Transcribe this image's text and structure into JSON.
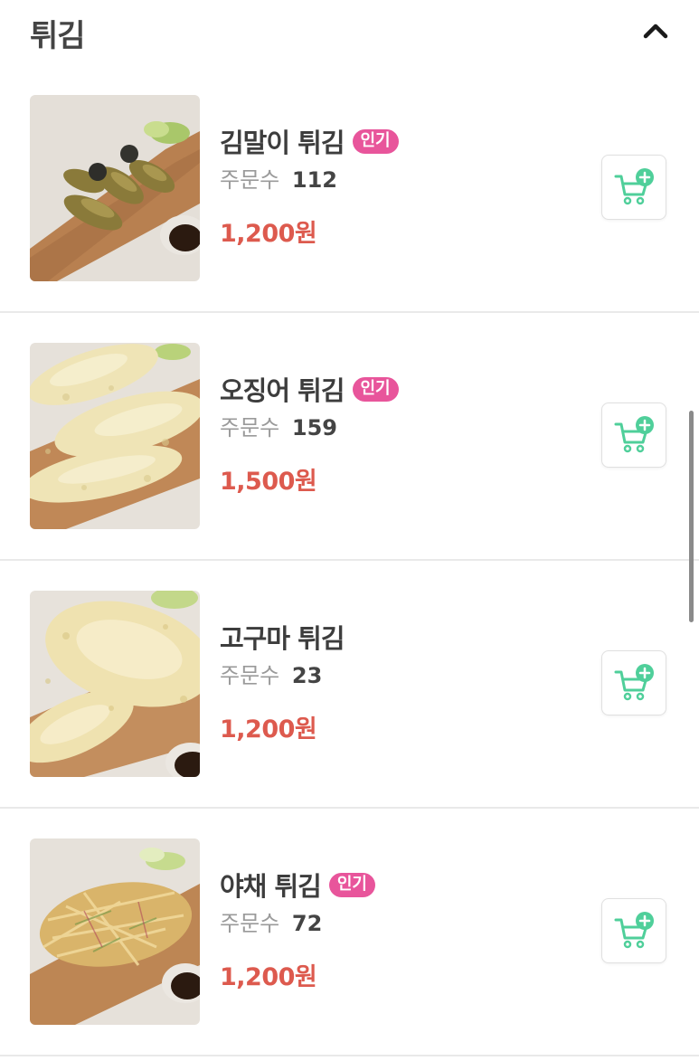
{
  "header": {
    "title": "튀김"
  },
  "items": [
    {
      "name": "김말이 튀김",
      "badge": "인기",
      "orders_label": "주문수",
      "orders": "112",
      "price": "1,200원"
    },
    {
      "name": "오징어 튀김",
      "badge": "인기",
      "orders_label": "주문수",
      "orders": "159",
      "price": "1,500원"
    },
    {
      "name": "고구마 튀김",
      "badge": "",
      "orders_label": "주문수",
      "orders": "23",
      "price": "1,200원"
    },
    {
      "name": "야채 튀김",
      "badge": "인기",
      "orders_label": "주문수",
      "orders": "72",
      "price": "1,200원"
    }
  ],
  "colors": {
    "price": "#dd5a4e",
    "badge": "#e8559b",
    "cart_icon": "#4fcf9a"
  },
  "icons": {
    "collapse": "chevron-up-icon",
    "cart": "cart-add-icon"
  }
}
